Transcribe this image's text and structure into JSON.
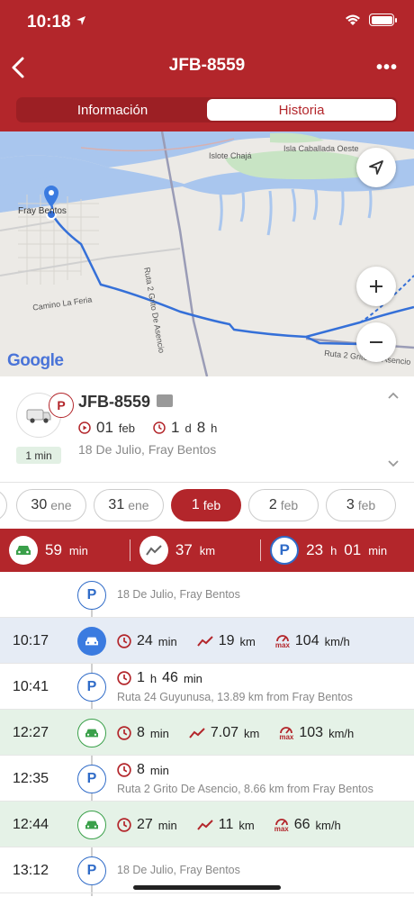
{
  "status_bar": {
    "time": "10:18"
  },
  "nav": {
    "title": "JFB-8559",
    "more_label": "•••"
  },
  "tabs": [
    {
      "label": "Información",
      "active": false
    },
    {
      "label": "Historia",
      "active": true
    }
  ],
  "map": {
    "labels": {
      "city": "Fray Bentos",
      "isla": "Isla Caballada Oeste",
      "islote": "Islote Chajá",
      "camino": "Camino La Feria",
      "ruta2": "Ruta 2 Grito De Asencio",
      "ruta2b": "Ruta 2 Grito De Asencio"
    },
    "google_label": "Google"
  },
  "vehicle": {
    "name": "JFB-8559",
    "status_badge": "P",
    "age": "1 min",
    "date_day": "01",
    "date_month": "feb",
    "duration_days": "1",
    "duration_days_unit": "d",
    "duration_hours": "8",
    "duration_hours_unit": "h",
    "address": "18 De Julio, Fray Bentos"
  },
  "dates": [
    {
      "day": "30",
      "month": "ene",
      "active": false
    },
    {
      "day": "31",
      "month": "ene",
      "active": false
    },
    {
      "day": "1",
      "month": "feb",
      "active": true
    },
    {
      "day": "2",
      "month": "feb",
      "active": false
    },
    {
      "day": "3",
      "month": "feb",
      "active": false
    }
  ],
  "summary": {
    "drive_time": "59",
    "drive_unit": "min",
    "distance": "37",
    "distance_unit": "km",
    "park_hours": "23",
    "park_hours_unit": "h",
    "park_minutes": "01",
    "park_minutes_unit": "min"
  },
  "timeline": [
    {
      "type": "park",
      "time": "",
      "address": "18 De Julio, Fray Bentos"
    },
    {
      "type": "drive",
      "time": "10:17",
      "duration": "24",
      "duration_unit": "min",
      "distance": "19",
      "distance_unit": "km",
      "max_speed": "104",
      "speed_unit": "km/h"
    },
    {
      "type": "park",
      "time": "10:41",
      "dur_h": "1",
      "dur_h_unit": "h",
      "dur_m": "46",
      "dur_m_unit": "min",
      "address": "Ruta 24 Guyunusa, 13.89 km from Fray Bentos"
    },
    {
      "type": "drive",
      "time": "12:27",
      "duration": "8",
      "duration_unit": "min",
      "distance": "7.07",
      "distance_unit": "km",
      "max_speed": "103",
      "speed_unit": "km/h"
    },
    {
      "type": "park",
      "time": "12:35",
      "dur_m": "8",
      "dur_m_unit": "min",
      "address": "Ruta 2 Grito De Asencio, 8.66 km from Fray Bentos"
    },
    {
      "type": "drive",
      "time": "12:44",
      "duration": "27",
      "duration_unit": "min",
      "distance": "11",
      "distance_unit": "km",
      "max_speed": "66",
      "speed_unit": "km/h"
    },
    {
      "type": "park",
      "time": "13:12",
      "address": "18 De Julio, Fray Bentos"
    }
  ],
  "labels": {
    "park_letter": "P",
    "max_label": "max"
  },
  "colors": {
    "brand": "#b3262b",
    "park_blue": "#2f6bc8",
    "drive_green": "#3aa04a",
    "drive_blue": "#3b7be0"
  }
}
